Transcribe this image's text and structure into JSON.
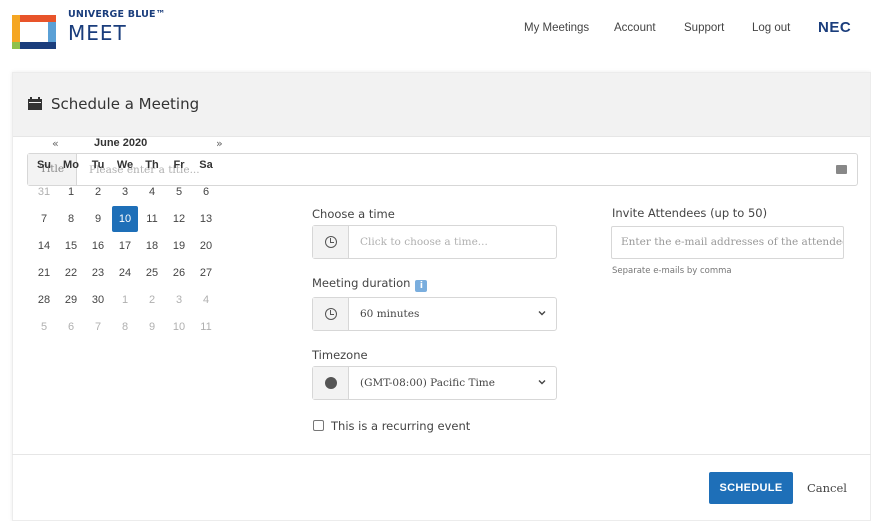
{
  "header": {
    "brand_top": "UNIVERGE BLUE™",
    "brand_bottom": "MEET",
    "nav": [
      "My Meetings",
      "Account",
      "Support",
      "Log out"
    ],
    "nec": "NEC",
    "logo_colors": [
      "#e8542a",
      "#f5a623",
      "#1a3d7c",
      "#8fc14b",
      "#5aa0d6"
    ]
  },
  "card": {
    "title": "Schedule a Meeting",
    "title_label": "Title",
    "title_placeholder": "Please enter a title..."
  },
  "calendar": {
    "prev": "«",
    "next": "»",
    "month": "June 2020",
    "dow": [
      "Su",
      "Mo",
      "Tu",
      "We",
      "Th",
      "Fr",
      "Sa"
    ],
    "weeks": [
      [
        [
          "31",
          1
        ],
        [
          "1",
          0
        ],
        [
          "2",
          0
        ],
        [
          "3",
          0
        ],
        [
          "4",
          0
        ],
        [
          "5",
          0
        ],
        [
          "6",
          0
        ]
      ],
      [
        [
          "7",
          0
        ],
        [
          "8",
          0
        ],
        [
          "9",
          0
        ],
        [
          "10",
          2
        ],
        [
          "11",
          0
        ],
        [
          "12",
          0
        ],
        [
          "13",
          0
        ]
      ],
      [
        [
          "14",
          0
        ],
        [
          "15",
          0
        ],
        [
          "16",
          0
        ],
        [
          "17",
          0
        ],
        [
          "18",
          0
        ],
        [
          "19",
          0
        ],
        [
          "20",
          0
        ]
      ],
      [
        [
          "21",
          0
        ],
        [
          "22",
          0
        ],
        [
          "23",
          0
        ],
        [
          "24",
          0
        ],
        [
          "25",
          0
        ],
        [
          "26",
          0
        ],
        [
          "27",
          0
        ]
      ],
      [
        [
          "28",
          0
        ],
        [
          "29",
          0
        ],
        [
          "30",
          0
        ],
        [
          "1",
          1
        ],
        [
          "2",
          1
        ],
        [
          "3",
          1
        ],
        [
          "4",
          1
        ]
      ],
      [
        [
          "5",
          1
        ],
        [
          "6",
          1
        ],
        [
          "7",
          1
        ],
        [
          "8",
          1
        ],
        [
          "9",
          1
        ],
        [
          "10",
          1
        ],
        [
          "11",
          1
        ]
      ]
    ]
  },
  "time": {
    "label": "Choose a time",
    "placeholder": "Click to choose a time...",
    "icon": "clock-icon"
  },
  "duration": {
    "label": "Meeting duration",
    "info_icon": "i",
    "value": "60 minutes",
    "icon": "clock-icon"
  },
  "timezone": {
    "label": "Timezone",
    "value": "(GMT-08:00) Pacific Time",
    "icon": "globe-icon"
  },
  "recurring": {
    "label": "This is a recurring event",
    "checked": false
  },
  "attendees": {
    "label": "Invite Attendees (up to 50)",
    "placeholder": "Enter the e-mail addresses of the attendees",
    "hint": "Separate e-mails by comma"
  },
  "footer": {
    "schedule": "SCHEDULE",
    "cancel": "Cancel"
  },
  "colors": {
    "primary": "#1e6fb8",
    "brand": "#1a3d7c"
  }
}
